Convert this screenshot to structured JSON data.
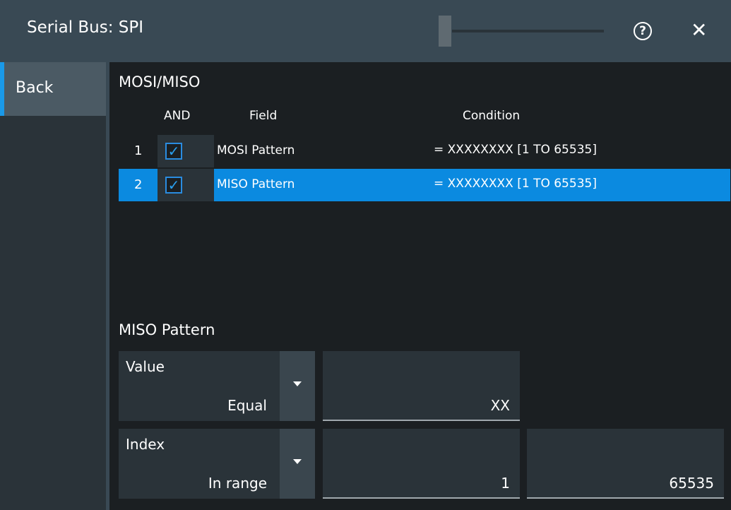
{
  "window": {
    "title": "Serial Bus: SPI",
    "help_symbol": "?",
    "close_symbol": "✕"
  },
  "sidebar": {
    "back_label": "Back"
  },
  "table": {
    "section_title": "MOSI/MISO",
    "headers": {
      "and": "AND",
      "field": "Field",
      "condition": "Condition"
    },
    "rows": [
      {
        "num": "1",
        "checked": true,
        "field": "MOSI Pattern",
        "condition": "= XXXXXXXX [1 TO 65535]",
        "selected": false
      },
      {
        "num": "2",
        "checked": true,
        "field": "MISO Pattern",
        "condition": "= XXXXXXXX [1 TO 65535]",
        "selected": true
      }
    ],
    "check_glyph": "✓"
  },
  "detail": {
    "section_title": "MISO Pattern",
    "value": {
      "label": "Value",
      "mode": "Equal",
      "input": "XX"
    },
    "index": {
      "label": "Index",
      "mode": "In range",
      "from": "1",
      "to": "65535"
    }
  },
  "colors": {
    "accent": "#0b8ae0",
    "titlebar": "#394954",
    "background": "#1b1f22"
  }
}
